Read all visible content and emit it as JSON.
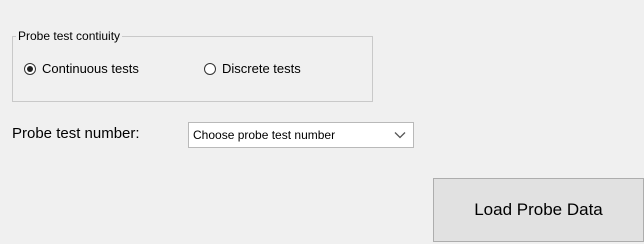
{
  "continuity_group": {
    "title": "Probe test contiuity",
    "options": [
      {
        "label": "Continuous tests",
        "selected": true
      },
      {
        "label": "Discrete tests",
        "selected": false
      }
    ]
  },
  "probe_test_number": {
    "label": "Probe test number:",
    "selected_value": "Choose probe test number"
  },
  "load_button": {
    "label": "Load Probe Data"
  },
  "icons": {
    "dropdown": "chevron-down-icon"
  }
}
